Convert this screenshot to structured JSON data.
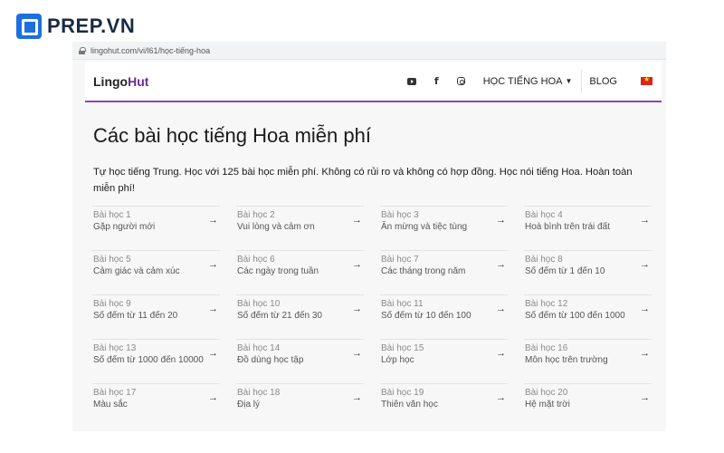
{
  "watermark": {
    "text": "PREP.VN"
  },
  "browser": {
    "url": "lingohut.com/vi/l61/học-tiếng-hoa"
  },
  "site": {
    "logo": {
      "part1": "Lingo",
      "part2": "Hut"
    },
    "nav": {
      "icons": [
        "youtube-icon",
        "facebook-icon",
        "instagram-icon"
      ],
      "facebook_glyph": "f",
      "menu_label": "HỌC TIẾNG HOA",
      "blog_label": "BLOG"
    },
    "title": "Các bài học tiếng Hoa miễn phí",
    "intro": "Tự học tiếng Trung. Học với 125 bài học miễn phí. Không có rủi ro và không có hợp đồng. Học nói tiếng Hoa. Hoàn toàn miễn phí!",
    "lessons": [
      {
        "num": "Bài học 1",
        "name": "Gặp người mới"
      },
      {
        "num": "Bài học 2",
        "name": "Vui lòng và cảm ơn"
      },
      {
        "num": "Bài học 3",
        "name": "Ăn mừng và tiệc tùng"
      },
      {
        "num": "Bài học 4",
        "name": "Hoà bình trên trái đất"
      },
      {
        "num": "Bài học 5",
        "name": "Cảm giác và cảm xúc"
      },
      {
        "num": "Bài học 6",
        "name": "Các ngày trong tuần"
      },
      {
        "num": "Bài học 7",
        "name": "Các tháng trong năm"
      },
      {
        "num": "Bài học 8",
        "name": "Số đếm từ 1 đến 10"
      },
      {
        "num": "Bài học 9",
        "name": "Số đếm từ 11 đến 20"
      },
      {
        "num": "Bài học 10",
        "name": "Số đếm từ 21 đến 30"
      },
      {
        "num": "Bài học 11",
        "name": "Số đếm từ 10 đến 100"
      },
      {
        "num": "Bài học 12",
        "name": "Số đếm từ 100 đến 1000"
      },
      {
        "num": "Bài học 13",
        "name": "Số đếm từ 1000 đến 10000"
      },
      {
        "num": "Bài học 14",
        "name": "Đồ dùng học tập"
      },
      {
        "num": "Bài học 15",
        "name": "Lớp học"
      },
      {
        "num": "Bài học 16",
        "name": "Môn học trên trường"
      },
      {
        "num": "Bài học 17",
        "name": "Màu sắc"
      },
      {
        "num": "Bài học 18",
        "name": "Địa lý"
      },
      {
        "num": "Bài học 19",
        "name": "Thiên văn học"
      },
      {
        "num": "Bài học 20",
        "name": "Hệ mặt trời"
      }
    ],
    "arrow_glyph": "→"
  }
}
